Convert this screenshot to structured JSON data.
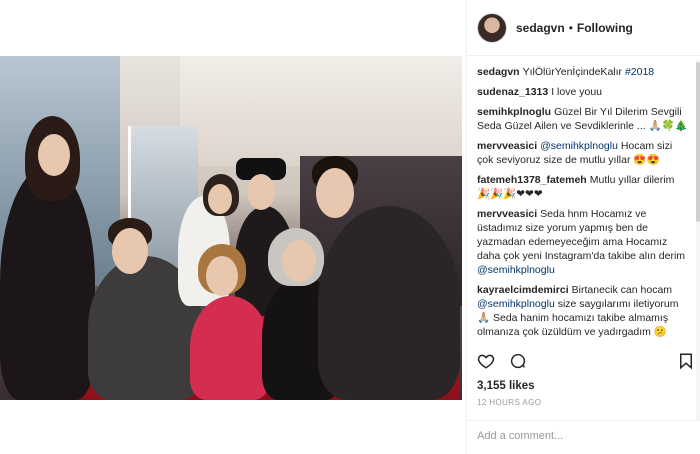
{
  "post": {
    "image_alt": "group photo"
  },
  "header": {
    "username": "sedagvn",
    "dot": "•",
    "follow_status": "Following"
  },
  "comments": [
    {
      "user": "sedagvn",
      "text": "YılÖlürYenİçindeKalır ",
      "tag": "#2018"
    },
    {
      "user": "sudenaz_1313",
      "text": "I love youu"
    },
    {
      "user": "semihkplnoglu",
      "text": "Güzel Bir Yıl Dilerim Sevgili Seda Güzel Ailen ve Sevdiklerinle ... 🙏🏼🍀🎄"
    },
    {
      "user": "mervveasici",
      "mention": "@semihkplnoglu",
      "text": " Hocam sizi çok seviyoruz size de mutlu yıllar 😍😍"
    },
    {
      "user": "fatemeh1378_fatemeh",
      "text": "Mutlu yıllar dilerim 🎉🎉🎉❤❤❤"
    },
    {
      "user": "mervveasici",
      "text": "Seda hnm Hocamız ve üstadımız size yorum yapmış ben de yazmadan edemeyeceğim ama Hocamız daha çok yeni Instagram'da takibe alın derim ",
      "mention_end": "@semihkplnoglu"
    },
    {
      "user": "kayraelcimdemirci",
      "text": "Birtanecik can hocam ",
      "mention_mid": "@semihkplnoglu",
      "text2": " size saygılarımı iletiyorum 🙏🏼 Seda hanim hocamızı takibe almamış olmanıza çok üzüldüm ve yadırgadım 😕"
    }
  ],
  "likes": "3,155 likes",
  "timestamp": "12 HOURS AGO",
  "add_comment_placeholder": "Add a comment...",
  "colors": {
    "link": "#003569",
    "border": "#efefef",
    "muted": "#999999"
  }
}
